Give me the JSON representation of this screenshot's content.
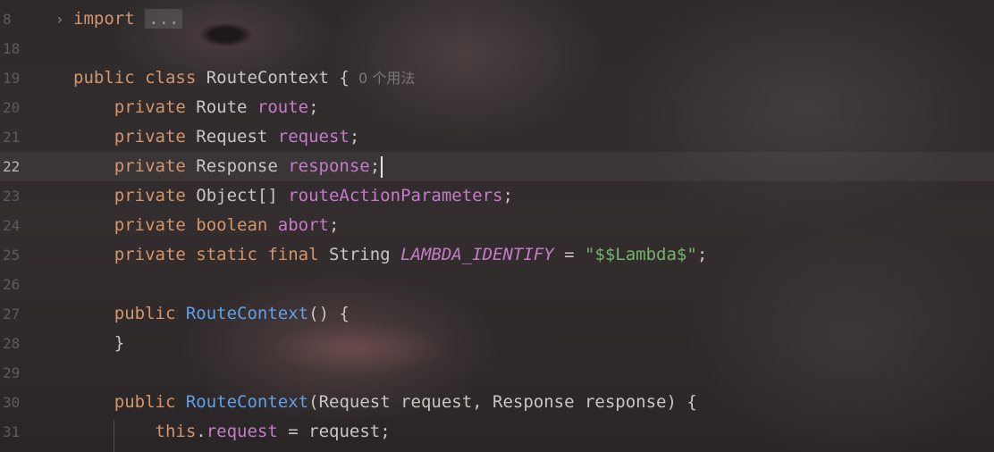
{
  "editor": {
    "current_line": "22",
    "lines": [
      {
        "n": "8",
        "tokens": [
          {
            "c": "kw",
            "t": "import"
          },
          {
            "c": "pl",
            "t": " "
          },
          {
            "c": "fold",
            "t": "..."
          }
        ]
      },
      {
        "n": "18",
        "tokens": []
      },
      {
        "n": "19",
        "tokens": [
          {
            "c": "kw",
            "t": "public class "
          },
          {
            "c": "ty",
            "t": "RouteContext {"
          },
          {
            "c": "hint",
            "t": "  0 个用法"
          }
        ]
      },
      {
        "n": "20",
        "tokens": [
          {
            "c": "kw",
            "t": "    private "
          },
          {
            "c": "ty",
            "t": "Route "
          },
          {
            "c": "fd",
            "t": "route"
          },
          {
            "c": "pl",
            "t": ";"
          }
        ]
      },
      {
        "n": "21",
        "tokens": [
          {
            "c": "kw",
            "t": "    private "
          },
          {
            "c": "ty",
            "t": "Request "
          },
          {
            "c": "fd",
            "t": "request"
          },
          {
            "c": "pl",
            "t": ";"
          }
        ]
      },
      {
        "n": "22",
        "tokens": [
          {
            "c": "kw",
            "t": "    private "
          },
          {
            "c": "ty",
            "t": "Response "
          },
          {
            "c": "fd",
            "t": "response"
          },
          {
            "c": "pl",
            "t": ";"
          },
          {
            "c": "caret",
            "t": ""
          }
        ]
      },
      {
        "n": "23",
        "tokens": [
          {
            "c": "kw",
            "t": "    private "
          },
          {
            "c": "ty",
            "t": "Object[] "
          },
          {
            "c": "fd",
            "t": "routeActionParameters"
          },
          {
            "c": "pl",
            "t": ";"
          }
        ]
      },
      {
        "n": "24",
        "tokens": [
          {
            "c": "kw",
            "t": "    private boolean "
          },
          {
            "c": "fd",
            "t": "abort"
          },
          {
            "c": "pl",
            "t": ";"
          }
        ]
      },
      {
        "n": "25",
        "tokens": [
          {
            "c": "kw",
            "t": "    private static final "
          },
          {
            "c": "ty",
            "t": "String "
          },
          {
            "c": "st",
            "t": "LAMBDA_IDENTIFY"
          },
          {
            "c": "pl",
            "t": " = "
          },
          {
            "c": "str",
            "t": "\"$$Lambda$\""
          },
          {
            "c": "pl",
            "t": ";"
          }
        ]
      },
      {
        "n": "26",
        "tokens": []
      },
      {
        "n": "27",
        "tokens": [
          {
            "c": "kw",
            "t": "    public "
          },
          {
            "c": "fn",
            "t": "RouteContext"
          },
          {
            "c": "pl",
            "t": "() {"
          }
        ]
      },
      {
        "n": "28",
        "tokens": [
          {
            "c": "pl",
            "t": "    }"
          }
        ]
      },
      {
        "n": "29",
        "tokens": []
      },
      {
        "n": "30",
        "tokens": [
          {
            "c": "kw",
            "t": "    public "
          },
          {
            "c": "fn",
            "t": "RouteContext"
          },
          {
            "c": "pl",
            "t": "(Request request, Response response) {"
          }
        ]
      },
      {
        "n": "31",
        "tokens": [
          {
            "c": "kw",
            "t": "        this"
          },
          {
            "c": "pl",
            "t": "."
          },
          {
            "c": "fd",
            "t": "request"
          },
          {
            "c": "pl",
            "t": " = request;"
          }
        ]
      }
    ]
  },
  "colors": {
    "keyword": "#d3956b",
    "field": "#c57bc7",
    "method": "#5fa0e8",
    "string": "#74b36d",
    "plain": "#c9c5c5",
    "line_number": "#5f5a5b"
  },
  "icons": {
    "fold": "chevron-right-icon"
  }
}
